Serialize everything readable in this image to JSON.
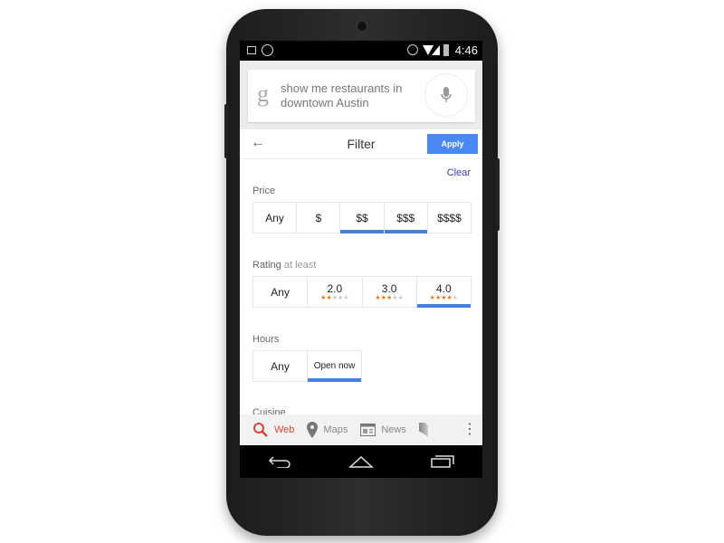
{
  "status_bar": {
    "time": "4:46",
    "icons": [
      "image-icon",
      "whatsapp-icon",
      "alarm-icon",
      "wifi-icon",
      "signal-icon",
      "battery-icon"
    ]
  },
  "search": {
    "logo": "g",
    "query": "show me restaurants in downtown Austin"
  },
  "header": {
    "title": "Filter",
    "apply_label": "Apply"
  },
  "clear_label": "Clear",
  "price": {
    "label": "Price",
    "options": [
      "Any",
      "$",
      "$$",
      "$$$",
      "$$$$"
    ],
    "selected": [
      "$$",
      "$$$"
    ]
  },
  "rating": {
    "label": "Rating",
    "sublabel": "at least",
    "options": [
      {
        "label": "Any"
      },
      {
        "label": "2.0",
        "stars": 2
      },
      {
        "label": "3.0",
        "stars": 3
      },
      {
        "label": "4.0",
        "stars": 4
      }
    ],
    "selected": "4.0"
  },
  "hours": {
    "label": "Hours",
    "options": [
      "Any",
      "Open now"
    ],
    "selected": "Open now"
  },
  "cuisine": {
    "label": "Cuisine"
  },
  "bottom_tabs": [
    {
      "label": "Web",
      "icon": "search-icon",
      "active": true
    },
    {
      "label": "Maps",
      "icon": "map-pin-icon"
    },
    {
      "label": "News",
      "icon": "newspaper-icon"
    }
  ],
  "colors": {
    "accent": "#4a89f3",
    "active_tab": "#d34836",
    "star": "#e07b20"
  }
}
